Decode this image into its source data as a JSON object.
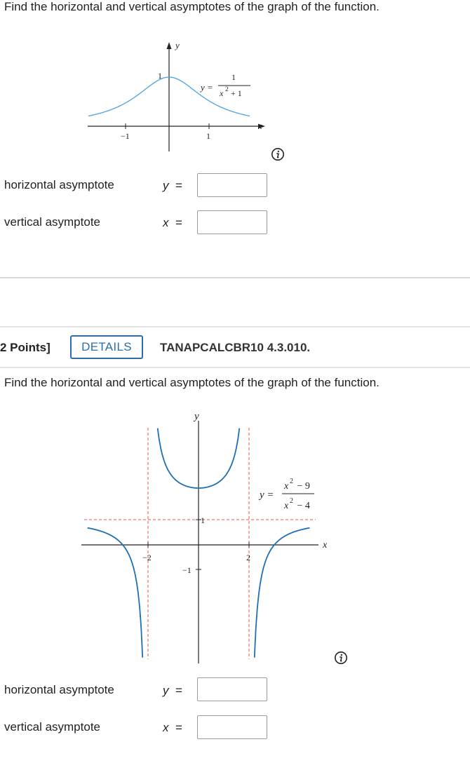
{
  "problem1": {
    "prompt": "Find the horizontal and vertical asymptotes of the graph of the function.",
    "graph": {
      "y_axis_label": "y",
      "x_axis_label": "x",
      "tick_y_1": "1",
      "tick_x_neg1": "−1",
      "tick_x_1": "1",
      "eq_lhs": "y =",
      "eq_num": "1",
      "eq_den_var": "x",
      "eq_den_exp": "2",
      "eq_den_rest": " + 1",
      "curve_color": "#4aa3df"
    },
    "horizontal_label": "horizontal asymptote",
    "horizontal_var": "y",
    "horizontal_eq": "=",
    "horizontal_value": "",
    "vertical_label": "vertical asymptote",
    "vertical_var": "x",
    "vertical_eq": "=",
    "vertical_value": "",
    "info_icon": "info-icon"
  },
  "problem2": {
    "points": "2 Points]",
    "details_label": "DETAILS",
    "code": "TANAPCALCBR10 4.3.010.",
    "prompt": "Find the horizontal and vertical asymptotes of the graph of the function.",
    "graph": {
      "y_axis_label": "y",
      "x_axis_label": "x",
      "tick_y_1": "1",
      "tick_y_neg1": "−1",
      "tick_x_neg2": "−2",
      "tick_x_2": "2",
      "eq_lhs": "y =",
      "num_var": "x",
      "num_exp": "2",
      "num_rest": " − 9",
      "den_var": "x",
      "den_exp": "2",
      "den_rest": " − 4",
      "curve_color": "#1f6fb5",
      "asymptote_color": "#e8534a"
    },
    "horizontal_label": "horizontal asymptote",
    "horizontal_var": "y",
    "horizontal_eq": "=",
    "horizontal_value": "",
    "vertical_label": "vertical asymptote",
    "vertical_var": "x",
    "vertical_eq": "=",
    "vertical_value": "",
    "info_icon": "info-icon"
  }
}
